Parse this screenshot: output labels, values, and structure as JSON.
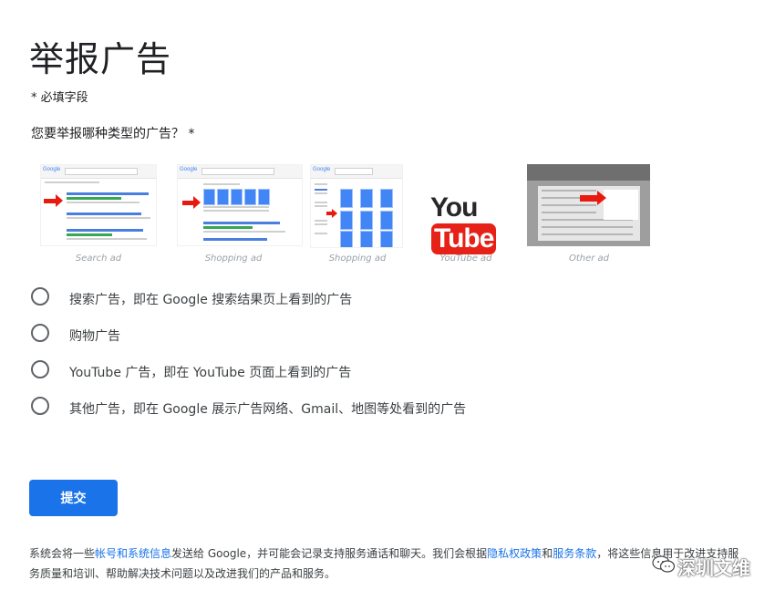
{
  "page": {
    "title": "举报广告",
    "required_note": "* 必填字段",
    "question": "您要举报哪种类型的广告？ *"
  },
  "ad_types": [
    {
      "caption": "Search ad"
    },
    {
      "caption": "Shopping ad"
    },
    {
      "caption": "Shopping ad"
    },
    {
      "caption": "YouTube ad"
    },
    {
      "caption": "Other ad"
    }
  ],
  "thumb_text": {
    "google_logo": "Google",
    "youtube_you": "You",
    "youtube_tube": "Tube"
  },
  "options": [
    {
      "label": "搜索广告，即在 Google 搜索结果页上看到的广告",
      "selected": false
    },
    {
      "label": "购物广告",
      "selected": false
    },
    {
      "label": "YouTube 广告，即在 YouTube 页面上看到的广告",
      "selected": false
    },
    {
      "label": "其他广告，即在 Google 展示广告网络、Gmail、地图等处看到的广告",
      "selected": false
    }
  ],
  "submit": {
    "label": "提交"
  },
  "privacy": {
    "part1": "系统会将一些",
    "link1": "帐号和系统信息",
    "part2": "发送给 Google，并可能会记录支持服务通话和聊天。我们会根据",
    "link2": "隐私权政策",
    "part3": "和",
    "link3": "服务条款",
    "part4": "，将这些信息用于改进支持服务质量和培训、帮助解决技术问题以及改进我们的产品和服务。"
  },
  "watermark": {
    "text": "深圳文维"
  },
  "colors": {
    "accent": "#1a73e8",
    "arrow": "#e8190f",
    "youtube_red": "#e62117"
  }
}
